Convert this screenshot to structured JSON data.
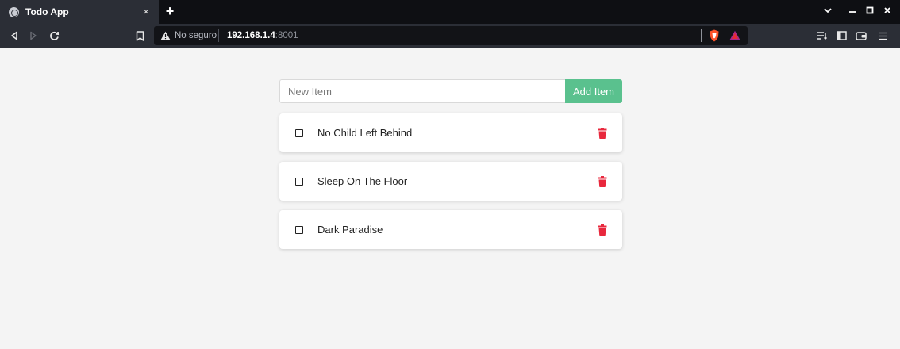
{
  "browser": {
    "tab_title": "Todo App",
    "tab_close": "×",
    "new_tab": "+",
    "address": {
      "security_label": "No seguro",
      "host": "192.168.1.4",
      "port": ":8001"
    }
  },
  "app": {
    "input_placeholder": "New Item",
    "input_value": "",
    "add_button_label": "Add Item",
    "accent_color": "#5ac18e",
    "delete_color": "#e8283d",
    "items": [
      {
        "text": "No Child Left Behind",
        "checked": false
      },
      {
        "text": "Sleep On The Floor",
        "checked": false
      },
      {
        "text": "Dark Paradise",
        "checked": false
      }
    ]
  }
}
